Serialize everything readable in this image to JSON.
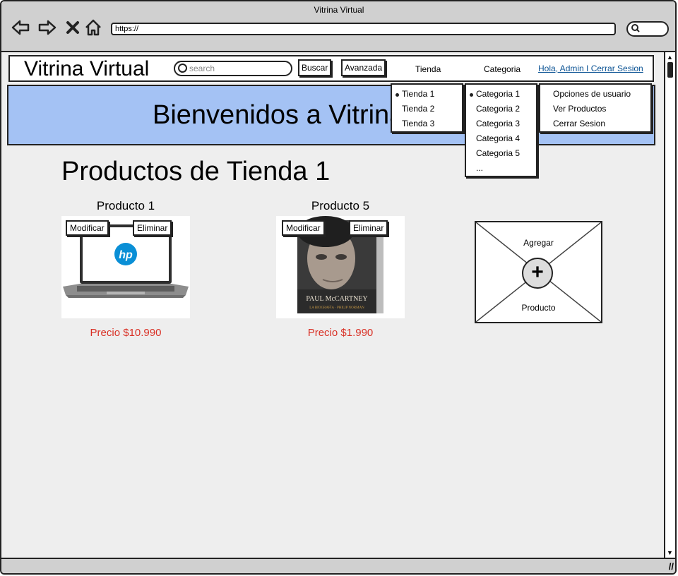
{
  "browser": {
    "title": "Vitrina Virtual",
    "url": "https://",
    "nav_icons": [
      "back-arrow-icon",
      "forward-arrow-icon",
      "close-icon",
      "home-icon"
    ]
  },
  "header": {
    "site_title": "Vitrina Virtual",
    "search_placeholder": "search",
    "buscar_label": "Buscar",
    "avanzada_label": "Avanzada",
    "tienda_label": "Tienda",
    "categoria_label": "Categoria",
    "user_link": "Hola, Admin I Cerrar Sesion"
  },
  "banner": {
    "text": "Bienvenidos a Vitrina Virtual"
  },
  "menus": {
    "tienda": [
      "Tienda 1",
      "Tienda 2",
      "Tienda 3"
    ],
    "categoria": [
      "Categoria 1",
      "Categoria 2",
      "Categoria 3",
      "Categoria 4",
      "Categoria 5",
      "..."
    ],
    "usuario": [
      "Opciones de usuario",
      "Ver Productos",
      "Cerrar Sesion"
    ]
  },
  "main": {
    "section_title": "Productos de Tienda 1",
    "products": [
      {
        "name": "Producto 1",
        "price": "Precio $10.990",
        "image_logo": "hp",
        "modify_label": "Modificar",
        "delete_label": "Eliminar"
      },
      {
        "name": "Producto 5",
        "price": "Precio $1.990",
        "book_title": "PAUL McCARTNEY",
        "book_subtitle": "LA BIOGRAFÍA · PHILIP NORMAN",
        "modify_label": "Modificar",
        "delete_label": "Eliminar"
      }
    ],
    "add_product": {
      "top_label": "Agregar",
      "bottom_label": "Producto",
      "icon": "plus-icon"
    }
  }
}
